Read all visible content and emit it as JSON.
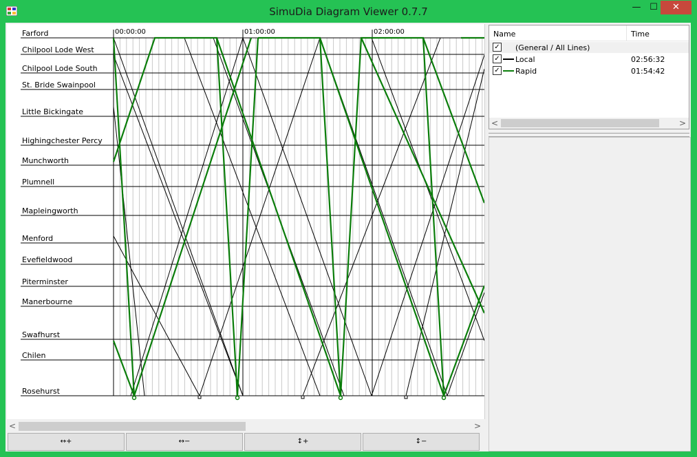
{
  "window": {
    "title": "SimuDia Diagram Viewer 0.7.7",
    "min_glyph": "—",
    "max_glyph": "☐",
    "close_glyph": "✕"
  },
  "diagram": {
    "time_labels": [
      "00:00:00",
      "01:00:00",
      "02:00:00"
    ],
    "stations": [
      {
        "name": "Farford"
      },
      {
        "name": "Chilpool Lode West"
      },
      {
        "name": "Chilpool Lode South"
      },
      {
        "name": "St. Bride Swainpool"
      },
      {
        "name": "Little Bickingate"
      },
      {
        "name": "Highingchester Percy"
      },
      {
        "name": "Munchworth"
      },
      {
        "name": "Plumnell"
      },
      {
        "name": "Mapleingworth"
      },
      {
        "name": "Menford"
      },
      {
        "name": "Evefieldwood"
      },
      {
        "name": "Piterminster"
      },
      {
        "name": "Manerbourne"
      },
      {
        "name": "Swafhurst"
      },
      {
        "name": "Chilen"
      },
      {
        "name": "Rosehurst"
      }
    ]
  },
  "buttons": [
    "↔+",
    "↔−",
    "↕+",
    "↕−"
  ],
  "lines_list": {
    "columns": {
      "name": "Name",
      "time": "Time"
    },
    "rows": [
      {
        "name": "(General / All Lines)",
        "time": "",
        "checked": true
      },
      {
        "name": "Local",
        "time": "02:56:32",
        "checked": true,
        "color": "#000000"
      },
      {
        "name": "Rapid",
        "time": "01:54:42",
        "checked": true,
        "color": "#0a7d0a"
      }
    ]
  },
  "scroll": {
    "left": "<",
    "right": ">"
  },
  "colors": {
    "titlebar": "#25c254",
    "local": "#000000",
    "rapid": "#0a7d0a",
    "close": "#c7483c"
  }
}
